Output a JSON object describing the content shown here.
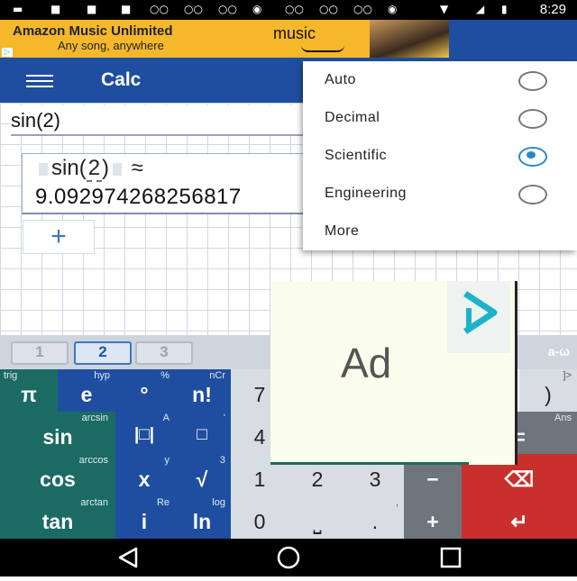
{
  "status_bar": {
    "time": "8:29"
  },
  "banner_ad": {
    "line1": "Amazon Music Unlimited",
    "line2": "Any song, anywhere",
    "brand": "music"
  },
  "app_bar": {
    "title": "Calc"
  },
  "calc": {
    "input": "sin(2)",
    "expr_func": "sin",
    "expr_lparen": "(",
    "expr_arg": "2",
    "expr_rparen": ")",
    "expr_approx": "≈",
    "result": "9.092974268256817",
    "add_label": "+"
  },
  "dropdown": {
    "options": [
      {
        "label": "Auto",
        "selected": false
      },
      {
        "label": "Decimal",
        "selected": false
      },
      {
        "label": "Scientific",
        "selected": true
      },
      {
        "label": "Engineering",
        "selected": false
      },
      {
        "label": "More"
      }
    ]
  },
  "keyboard": {
    "tabs": [
      "1",
      "2",
      "3"
    ],
    "active_tab": "2",
    "tabs_right": "a-ω",
    "keys": {
      "pi": {
        "main": "π",
        "sub": "trig"
      },
      "e": {
        "main": "e",
        "sub": "hyp"
      },
      "deg": {
        "main": "°",
        "sub": "%"
      },
      "fact": {
        "main": "n!",
        "sub": "nCr"
      },
      "sin": {
        "main": "sin",
        "sub": "arcsin"
      },
      "abs": {
        "main": "|□|",
        "sub": "A"
      },
      "pow": {
        "main": "□",
        "sub": "'"
      },
      "cos": {
        "main": "cos",
        "sub": "arccos"
      },
      "x": {
        "main": "x",
        "sub": "y"
      },
      "sqrt": {
        "main": "√",
        "sub": "3"
      },
      "tan": {
        "main": "tan",
        "sub": "arctan"
      },
      "i": {
        "main": "i",
        "sub": "Re"
      },
      "ln": {
        "main": "ln",
        "sub": "log"
      },
      "seven": {
        "main": "7"
      },
      "four": {
        "main": "4"
      },
      "one": {
        "main": "1"
      },
      "two": {
        "main": "2"
      },
      "three": {
        "main": "3"
      },
      "zero": {
        "main": "0"
      },
      "space": {
        "main": "⎵"
      },
      "dot": {
        "main": ".",
        "sub": ","
      },
      "rparen": {
        "main": ")",
        "sub": "]>"
      },
      "equals": {
        "main": "=",
        "sub": "Ans"
      },
      "minus": {
        "main": "−"
      },
      "plus": {
        "main": "+"
      },
      "backspace": {
        "main": "⌫"
      },
      "enter": {
        "main": "↵"
      }
    }
  },
  "ad_overlay": {
    "text": "Ad"
  },
  "colors": {
    "appbar": "#1f4ea0",
    "teal": "#1b6b64",
    "red": "#c9302c",
    "accent": "#2a8ac7"
  }
}
